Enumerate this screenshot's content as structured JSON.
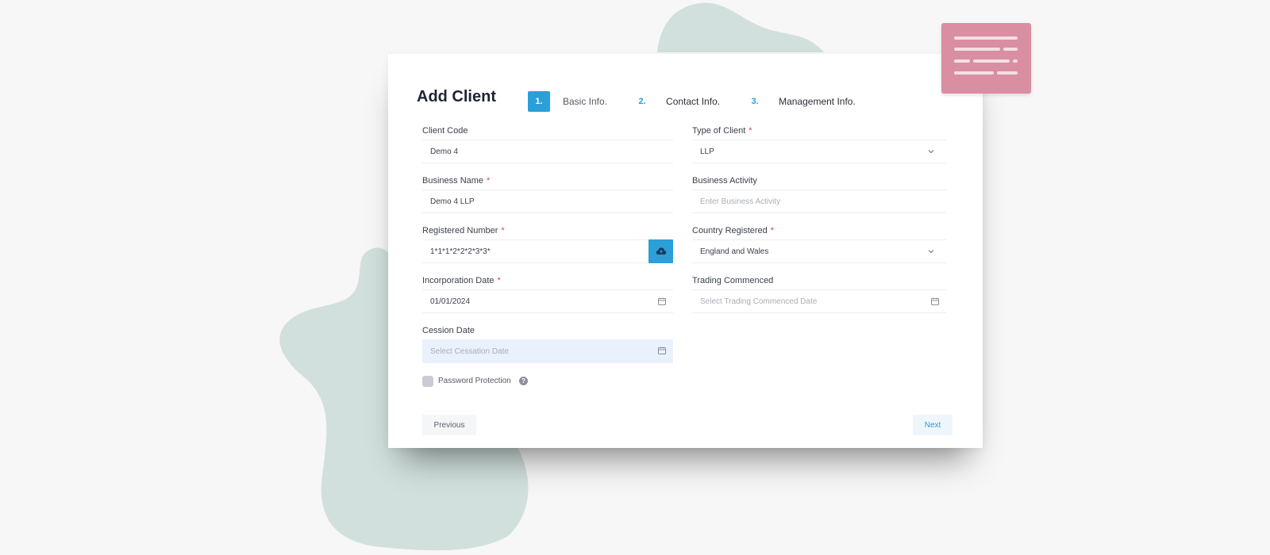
{
  "form": {
    "title": "Add Client",
    "steps": [
      {
        "num": "1.",
        "label": "Basic Info."
      },
      {
        "num": "2.",
        "label": "Contact Info."
      },
      {
        "num": "3.",
        "label": "Management Info."
      }
    ],
    "active_step": 1,
    "fields": {
      "client_code": {
        "label": "Client Code",
        "value": "Demo 4",
        "required": false
      },
      "type_of_client": {
        "label": "Type of Client",
        "value": "LLP",
        "required": true
      },
      "business_name": {
        "label": "Business Name",
        "value": "Demo 4 LLP",
        "required": true
      },
      "business_activity": {
        "label": "Business Activity",
        "placeholder": "Enter Business Activity",
        "required": false
      },
      "registered_number": {
        "label": "Registered Number",
        "value": "1*1*1*2*2*2*3*3*",
        "required": true
      },
      "country_registered": {
        "label": "Country Registered",
        "value": "England and Wales",
        "required": true
      },
      "incorporation_date": {
        "label": "Incorporation Date",
        "value": "01/01/2024",
        "required": true
      },
      "trading_commenced": {
        "label": "Trading Commenced",
        "placeholder": "Select Trading Commenced Date",
        "required": false
      },
      "cession_date": {
        "label": "Cession Date",
        "placeholder": "Select Cessation Date",
        "required": false
      }
    },
    "required_mark": "*",
    "password_protection": {
      "label": "Password Protection",
      "checked": false,
      "help_icon": "question-circle-icon"
    },
    "buttons": {
      "previous": "Previous",
      "next": "Next"
    }
  },
  "icons": {
    "upload": "cloud-upload-icon",
    "calendar": "calendar-icon",
    "dropdown": "chevron-down-icon",
    "decor": "document-lines-icon"
  },
  "colors": {
    "accent": "#2a9fd8",
    "required": "#e0413b",
    "blob": "#d1e0dd",
    "decor_card": "#d98ea1",
    "cession_bg": "#e9f1fd"
  }
}
